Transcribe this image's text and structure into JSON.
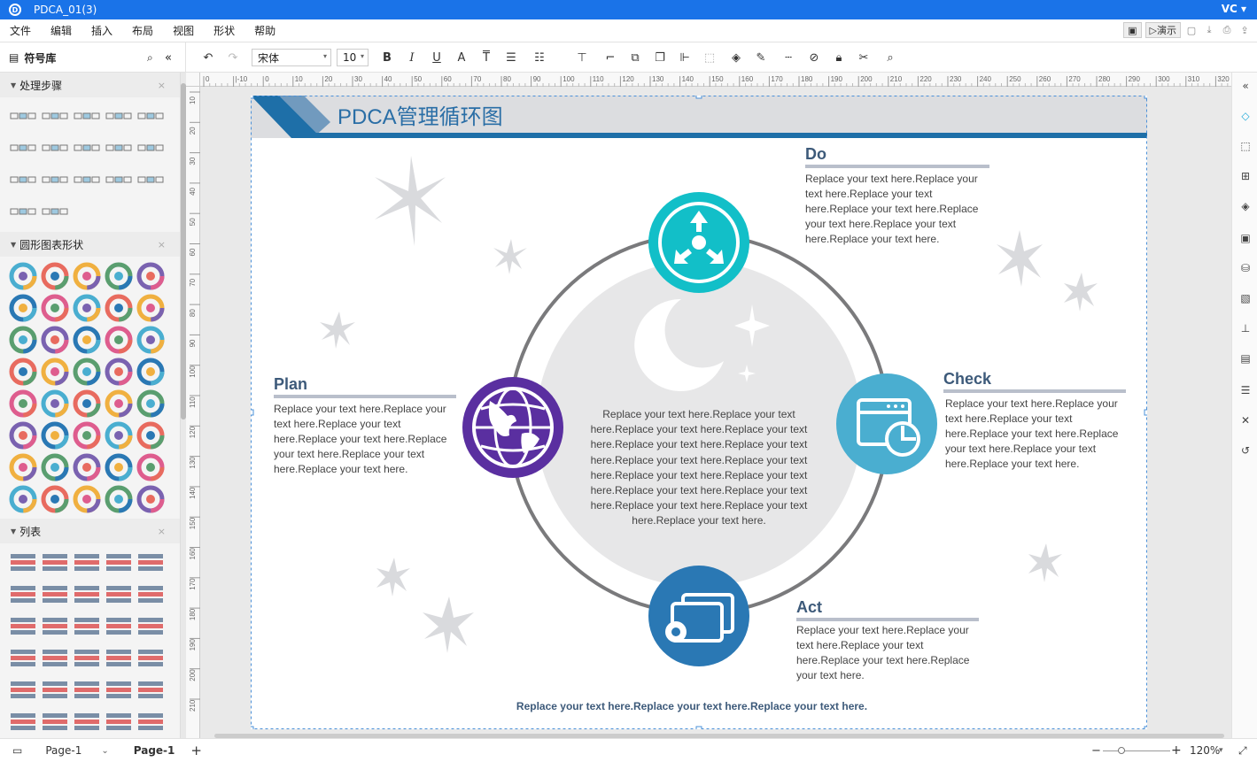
{
  "window": {
    "title": "PDCA_01(3)",
    "user": "VC"
  },
  "menu": [
    "文件",
    "编辑",
    "插入",
    "布局",
    "视图",
    "形状",
    "帮助"
  ],
  "menu_right": {
    "present_label": "演示"
  },
  "toolbar": {
    "font": "宋体",
    "size": "10"
  },
  "library": {
    "title": "符号库",
    "sections": [
      {
        "label": "处理步骤"
      },
      {
        "label": "圆形图表形状"
      },
      {
        "label": "列表"
      }
    ]
  },
  "ruler": {
    "h_ticks": [
      "0",
      "|-10",
      "0",
      "10",
      "20",
      "30",
      "40",
      "50",
      "60",
      "70",
      "80",
      "90",
      "100",
      "110",
      "120",
      "130",
      "140",
      "150",
      "160",
      "170",
      "180",
      "190",
      "200",
      "210",
      "220",
      "230",
      "240",
      "250",
      "260",
      "270",
      "280",
      "290",
      "300",
      "310",
      "320"
    ],
    "v_ticks": [
      "10",
      "20",
      "30",
      "40",
      "50",
      "60",
      "70",
      "80",
      "90",
      "100",
      "110",
      "120",
      "130",
      "140",
      "150",
      "160",
      "170",
      "180",
      "190",
      "200",
      "210"
    ]
  },
  "diagram": {
    "title": "PDCA管理循环图",
    "center_text": "Replace your text here.Replace your text here.Replace your text here.Replace your text here.Replace your text here.Replace your text here.Replace your text here.Replace your text here.Replace your text here.Replace your text here.Replace your text here.Replace your text here.Replace your text here.Replace your text here.Replace your text here.",
    "footer": "Replace your text here.Replace your text here.Replace your text here.",
    "nodes": {
      "do": {
        "title": "Do",
        "text": "Replace your text here.Replace your text here.Replace your text here.Replace your text here.Replace your text here.Replace your text here.Replace your text here.",
        "color": "#12bfc8"
      },
      "check": {
        "title": "Check",
        "text": "Replace your text here.Replace your text here.Replace your text here.Replace your text here.Replace your text here.Replace your text here.Replace your text here.",
        "color": "#4aaed0"
      },
      "act": {
        "title": "Act",
        "text": "Replace your text here.Replace your text here.Replace your text here.Replace your text here.Replace your text here.",
        "color": "#2a78b4"
      },
      "plan": {
        "title": "Plan",
        "text": "Replace your text here.Replace your text here.Replace your text here.Replace your text here.Replace your text here.Replace your text here.Replace your text here.",
        "color": "#5a2fa0"
      }
    }
  },
  "status": {
    "page_tab": "Page-1",
    "active_page": "Page-1",
    "zoom": "120%"
  },
  "colors": {
    "accent": "#1a73e8",
    "title_text": "#2a6ea6",
    "heading": "#3d5a7a",
    "banner": "#1e6fa8"
  }
}
